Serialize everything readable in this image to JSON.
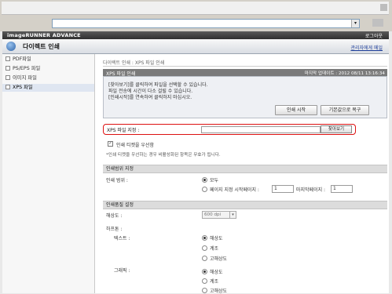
{
  "header": {
    "product": "imageRUNNER ADVANCE",
    "logout": "로그아웃"
  },
  "title": {
    "text": "다이렉트 인쇄",
    "admin_link": "관리자에게 메일"
  },
  "sidebar": {
    "items": [
      {
        "label": "PDF파일"
      },
      {
        "label": "PS/EPS 파일"
      },
      {
        "label": "이미지 파일"
      },
      {
        "label": "XPS 파일"
      }
    ]
  },
  "breadcrumb": "다이렉트 인쇄 : XPS 파일 인쇄",
  "info": {
    "title": "XPS 파일 인쇄",
    "updated": "마지막 업데이트 : 2012 08/11 13:16:34",
    "lines": [
      "[찾아보기]를 클릭하여 파일을 선택할 수 있습니다.",
      "파일 전송에 시간이 다소 걸릴 수 있습니다.",
      "[인쇄시작]를 연속하여 클릭하지 마십시오."
    ],
    "start_button": "인쇄 시작",
    "reset_button": "기본값으로 복구"
  },
  "file": {
    "label": "XPS 파일 지정 :",
    "value": "",
    "browse_button": "찾아보기"
  },
  "ticket": {
    "label": "인쇄 티켓을 우선함",
    "checked": true,
    "note": "*인쇄 티켓을 우선하는 경우 비활성화된 항목은 무효가 됩니다."
  },
  "range": {
    "section": "인쇄범위 지정",
    "label": "인쇄 범위 :",
    "all": "모두",
    "pages_label": "페이지 지정 시작페이지 :",
    "end_label": "마지막페이지 :",
    "start_value": "1",
    "end_value": "1"
  },
  "quality": {
    "section": "인쇄품질 설정",
    "resolution_label": "해상도 :",
    "resolution_value": "600 dpi",
    "halftone_label": "하프톤 :",
    "text_label": "텍스트 :",
    "graphics_label": "그래픽 :",
    "options": [
      "해상도",
      "계조",
      "고해상도"
    ]
  }
}
